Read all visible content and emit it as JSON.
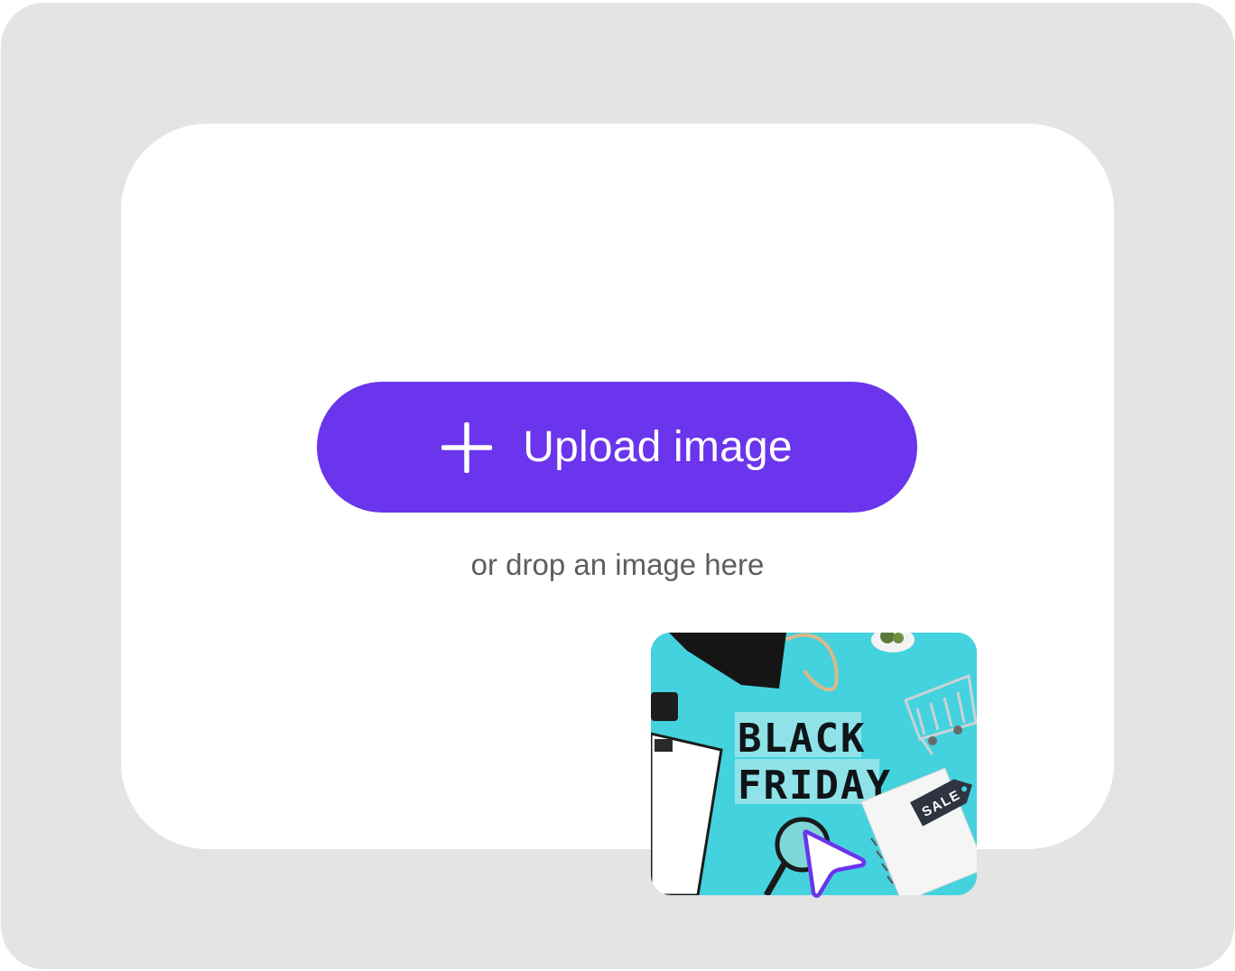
{
  "upload": {
    "button_label": "Upload image",
    "hint": "or drop an image here",
    "accent_color": "#6a35ec"
  },
  "thumbnail": {
    "sign_line_1": "BLACK",
    "sign_line_2": "FRIDAY",
    "tag_text": "SALE",
    "background_color": "#44d2de"
  },
  "icons": {
    "add": "plus-icon",
    "cursor": "cursor-arrow-icon"
  }
}
